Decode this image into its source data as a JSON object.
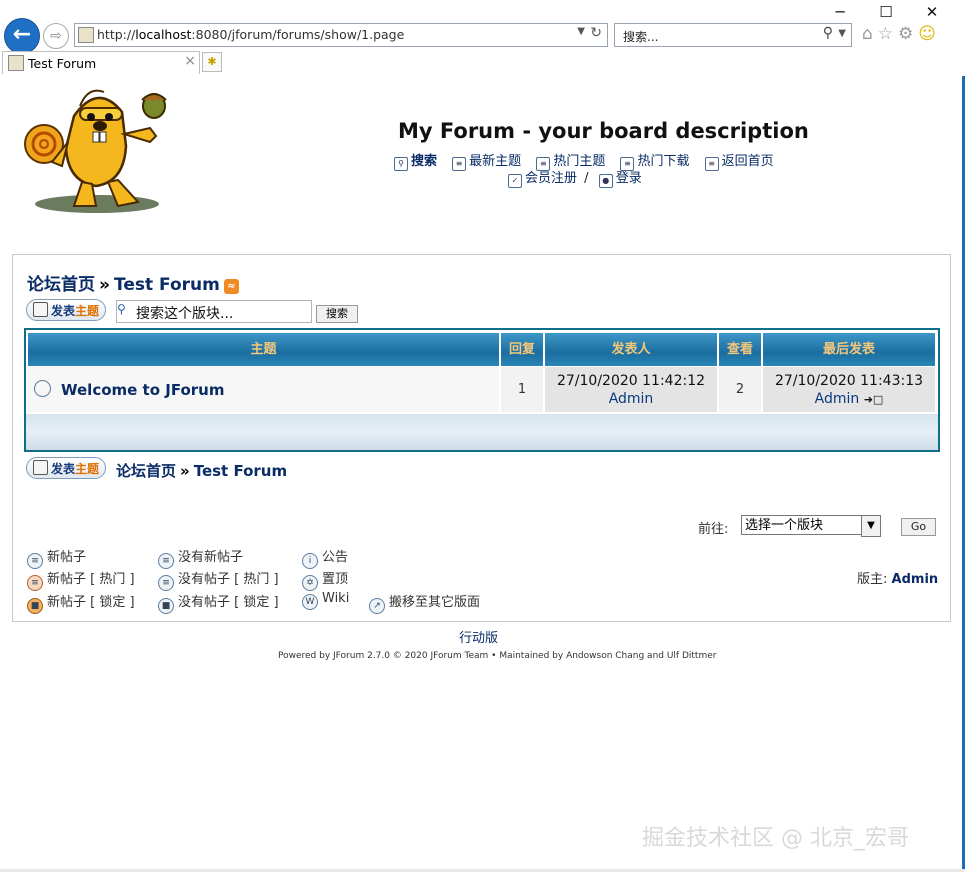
{
  "browser": {
    "url_prefix": "http://",
    "url_host": "localhost",
    "url_rest": ":8080/jforum/forums/show/1.page",
    "search_placeholder": "搜索...",
    "tab_title": "Test Forum",
    "window_controls": [
      "─",
      "☐",
      "✕"
    ]
  },
  "header": {
    "title": "My Forum - your board description",
    "nav": [
      {
        "label": "搜索",
        "bold": true
      },
      {
        "label": "最新主题"
      },
      {
        "label": "热门主题"
      },
      {
        "label": "热门下载"
      },
      {
        "label": "返回首页"
      }
    ],
    "register": "会员注册",
    "slash": "/",
    "login": "登录"
  },
  "breadcrumb": {
    "home": "论坛首页",
    "sep": "»",
    "forum": "Test Forum"
  },
  "toolbar": {
    "post_prefix": "发表",
    "post_highlight": "主题",
    "search_value": "搜索这个版块...",
    "search_button": "搜索"
  },
  "table": {
    "headers": [
      "主题",
      "回复",
      "发表人",
      "查看",
      "最后发表"
    ],
    "rows": [
      {
        "topic": "Welcome to JForum",
        "replies": "1",
        "author_date": "27/10/2020 11:42:12",
        "author": "Admin",
        "views": "2",
        "last_date": "27/10/2020 11:43:13",
        "last_user": "Admin"
      }
    ]
  },
  "goto": {
    "label": "前往:",
    "selected": "选择一个版块",
    "button": "Go"
  },
  "legend": {
    "col1": [
      "新帖子",
      "新帖子 [ 热门 ]",
      "新帖子 [ 锁定 ]"
    ],
    "col2": [
      "没有新帖子",
      "没有帖子 [ 热门 ]",
      "没有帖子 [ 锁定 ]"
    ],
    "col3": [
      "公告",
      "置顶",
      "Wiki"
    ],
    "move": "搬移至其它版面"
  },
  "moderator": {
    "label": "版主:",
    "name": "Admin"
  },
  "footer": {
    "mobile": "行动版",
    "powered": "Powered by JForum 2.7.0 © 2020 JForum Team • Maintained by Andowson Chang and Ulf Dittmer"
  },
  "watermark": "掘金技术社区 @ 北京_宏哥"
}
